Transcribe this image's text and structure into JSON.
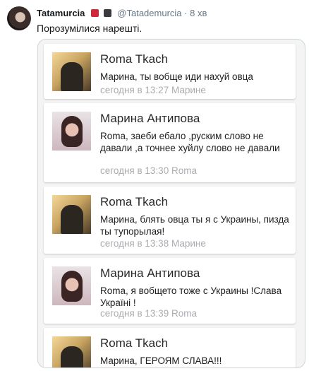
{
  "tweet": {
    "author_name": "Tatamurcia",
    "handle": "@Tatademurcia",
    "time": "· 8 хв",
    "text": "Порозумілися нарешті."
  },
  "screenshot": {
    "cards": [
      {
        "name": "Roma Tkach",
        "message": "Марина, ты вобще иди нахуй овца",
        "meta": "сегодня в 13:27 Марине",
        "avatar": "roma-photo"
      },
      {
        "name": "Марина Антипова",
        "message": "Roma, заеби ебало ,руским слово не давали ,а точнее хуйлу слово не давали",
        "meta": "сегодня в 13:30 Roma",
        "avatar": "marina-photo"
      },
      {
        "name": "Roma Tkach",
        "message": "Марина, блять овца ты я с Украины, пизда ты тупорылая!",
        "meta": "сегодня в 13:38 Марине",
        "avatar": "roma-photo"
      },
      {
        "name": "Марина Антипова",
        "message": "Roma, я вобщето тоже с Украины !Слава Україні !",
        "meta": "сегодня в 13:39 Roma",
        "avatar": "marina-photo"
      },
      {
        "name": "Roma Tkach",
        "message": "Марина, ГЕРОЯМ СЛАВА!!!",
        "meta": "",
        "avatar": "roma-photo"
      }
    ]
  }
}
